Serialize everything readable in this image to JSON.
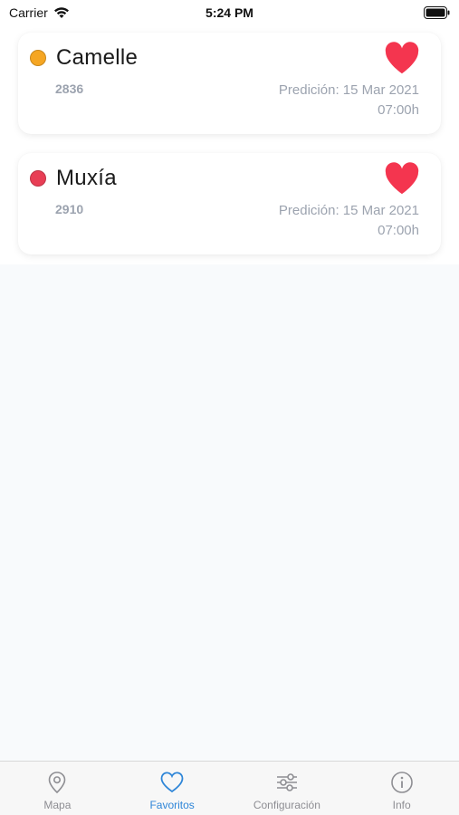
{
  "status_bar": {
    "carrier": "Carrier",
    "time": "5:24 PM"
  },
  "favorites": [
    {
      "name": "Camelle",
      "code": "2836",
      "prediction": "Predición: 15 Mar 2021",
      "hour": "07:00h",
      "status_color": "#f5a623"
    },
    {
      "name": "Muxía",
      "code": "2910",
      "prediction": "Predición: 15 Mar 2021",
      "hour": "07:00h",
      "status_color": "#e83e55"
    }
  ],
  "tab_bar": {
    "tabs": [
      {
        "label": "Mapa",
        "icon": "map-pin-icon",
        "active": false
      },
      {
        "label": "Favoritos",
        "icon": "heart-outline-icon",
        "active": true
      },
      {
        "label": "Configuración",
        "icon": "sliders-icon",
        "active": false
      },
      {
        "label": "Info",
        "icon": "info-icon",
        "active": false
      }
    ]
  },
  "colors": {
    "heart": "#f4354f",
    "accent": "#2f86d8",
    "inactive": "#8e8e93"
  }
}
